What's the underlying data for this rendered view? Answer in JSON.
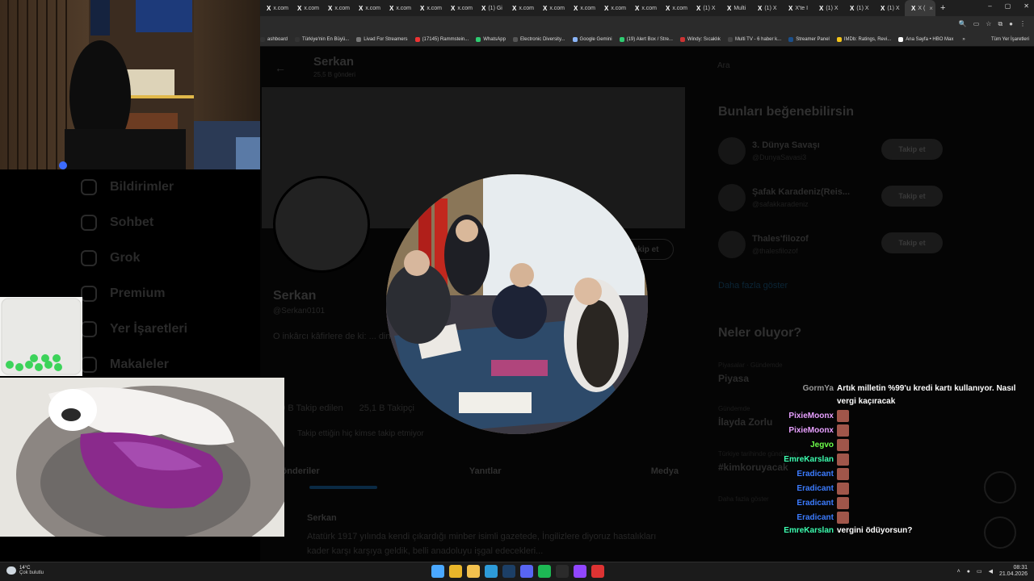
{
  "browser": {
    "tabs": [
      {
        "label": "x.com",
        "active": false
      },
      {
        "label": "x.com",
        "active": false
      },
      {
        "label": "x.com",
        "active": false
      },
      {
        "label": "x.com",
        "active": false
      },
      {
        "label": "x.com",
        "active": false
      },
      {
        "label": "x.com",
        "active": false
      },
      {
        "label": "x.com",
        "active": false
      },
      {
        "label": "(1) Gi",
        "active": false
      },
      {
        "label": "x.com",
        "active": false
      },
      {
        "label": "x.com",
        "active": false
      },
      {
        "label": "x.com",
        "active": false
      },
      {
        "label": "x.com",
        "active": false
      },
      {
        "label": "x.com",
        "active": false
      },
      {
        "label": "x.com",
        "active": false
      },
      {
        "label": "(1) X",
        "active": false
      },
      {
        "label": "Multi",
        "active": false
      },
      {
        "label": "(1) X",
        "active": false
      },
      {
        "label": "X'te I",
        "active": false
      },
      {
        "label": "(1) X",
        "active": false
      },
      {
        "label": "(1) X",
        "active": false
      },
      {
        "label": "(1) X",
        "active": false
      },
      {
        "label": "X (",
        "active": true
      }
    ],
    "new_tab": "+",
    "window_controls": [
      "–",
      "▢",
      "✕"
    ],
    "bookmarks": [
      {
        "label": "ashboard",
        "color": "#333"
      },
      {
        "label": "Türkiye'nin En Büyü...",
        "color": "#333"
      },
      {
        "label": "Livad For Streamers",
        "color": "#777"
      },
      {
        "label": "(17145) Rammstein...",
        "color": "#e33"
      },
      {
        "label": "WhatsApp",
        "color": "#2ecc71"
      },
      {
        "label": "Electronic Diversity...",
        "color": "#555"
      },
      {
        "label": "Google Gemini",
        "color": "#8ab4f8"
      },
      {
        "label": "(19) Alert Box / Stre...",
        "color": "#2ecc71"
      },
      {
        "label": "Windy: Sıcaklık",
        "color": "#c33"
      },
      {
        "label": "Multi TV - 6 haber k...",
        "color": "#444"
      },
      {
        "label": "Streamer Panel",
        "color": "#1b4f8a"
      },
      {
        "label": "IMDb: Ratings, Revi...",
        "color": "#f5c518"
      },
      {
        "label": "Ana Sayfa • HBO Max",
        "color": "#fff"
      }
    ],
    "bookmarks_more": "»",
    "all_bookmarks": "Tüm Yer İşaretleri"
  },
  "profile": {
    "header_name": "Serkan",
    "header_posts": "25,5 B gönderi",
    "follow_button": "Takip et",
    "name": "Serkan",
    "handle": "@Serkan0101",
    "bio": "O inkârcı kâfirlere de ki: ... dininiz size, benim dinim bana. Onlar ... Al-i İmran Suresi 13",
    "stats": [
      "1,9 B Takip edilen",
      "25,1 B Takipçi"
    ],
    "followed_by": "Takip ettiğin hiç kimse takip etmiyor",
    "tabs": [
      "Gönderiler",
      "Yanıtlar",
      "Medya"
    ],
    "tweet_name": "Serkan",
    "tweet_text": "Atatürk 1917 yılında kendi çıkardığı minber isimli gazetede, İngilizlere diyoruz hastalıkları kader karşı karşıya geldik, belli anadoluyu işgal edecekleri..."
  },
  "nav": {
    "items": [
      "Bildirimler",
      "Sohbet",
      "Grok",
      "Premium",
      "Yer İşaretleri",
      "Makaleler"
    ]
  },
  "right": {
    "search_placeholder": "Ara",
    "wtf_title": "Bunları beğenebilirsin",
    "suggestions": [
      {
        "name": "3. Dünya Savaşı",
        "handle": "@DunyaSavasi3",
        "button": "Takip et"
      },
      {
        "name": "Şafak Karadeniz(Reis...",
        "handle": "@safakkaradeniz",
        "button": "Takip et"
      },
      {
        "name": "Thales'filozof",
        "handle": "@thalesfilozof",
        "button": "Takip et"
      }
    ],
    "show_more": "Daha fazla göster",
    "trends_title": "Neler oluyor?",
    "trends": [
      {
        "cat": "Piyasalar · Gündemde",
        "title": "Piyasa"
      },
      {
        "cat": "Gündemde",
        "title": "İlayda Zorlu"
      },
      {
        "cat": "Türkiye tarihinde gündemde",
        "title": "#kimkoruyacak"
      },
      {
        "cat": "Daha fazla göster",
        "title": ""
      }
    ]
  },
  "chat": [
    {
      "user": "GormYa",
      "color": "#9a9a9a",
      "msg": "Artık milletin %99'u kredi kartı kullanıyor. Nasıl vergi kaçıracak",
      "emote": false
    },
    {
      "user": "PixieMoonx",
      "color": "#e8a0ff",
      "msg": "",
      "emote": true
    },
    {
      "user": "PixieMoonx",
      "color": "#e8a0ff",
      "msg": "",
      "emote": true
    },
    {
      "user": "Jegvo",
      "color": "#6dff4a",
      "msg": "",
      "emote": true
    },
    {
      "user": "EmreKarslan",
      "color": "#3cffb0",
      "msg": "",
      "emote": true
    },
    {
      "user": "Eradicant",
      "color": "#3c7cff",
      "msg": "",
      "emote": true
    },
    {
      "user": "Eradicant",
      "color": "#3c7cff",
      "msg": "",
      "emote": true
    },
    {
      "user": "Eradicant",
      "color": "#3c7cff",
      "msg": "",
      "emote": true
    },
    {
      "user": "Eradicant",
      "color": "#3c7cff",
      "msg": "",
      "emote": true
    },
    {
      "user": "EmreKarslan",
      "color": "#3cffb0",
      "msg": "vergini ödüyorsun?",
      "emote": false
    }
  ],
  "taskbar": {
    "temperature": "14°C",
    "condition": "Çok bulutlu",
    "apps": [
      {
        "name": "start",
        "color": "#4aa8ff"
      },
      {
        "name": "chrome",
        "color": "#e9b62a"
      },
      {
        "name": "file-explorer",
        "color": "#f2c14e"
      },
      {
        "name": "edge",
        "color": "#2d9bd9"
      },
      {
        "name": "steam",
        "color": "#1c3f66"
      },
      {
        "name": "discord",
        "color": "#5865f2"
      },
      {
        "name": "spotify",
        "color": "#1db954"
      },
      {
        "name": "obs",
        "color": "#2b2b2b"
      },
      {
        "name": "twitch-app",
        "color": "#9146ff"
      },
      {
        "name": "app-circle",
        "color": "#d33"
      }
    ],
    "time": "08:31",
    "date": "21.04.2026"
  }
}
